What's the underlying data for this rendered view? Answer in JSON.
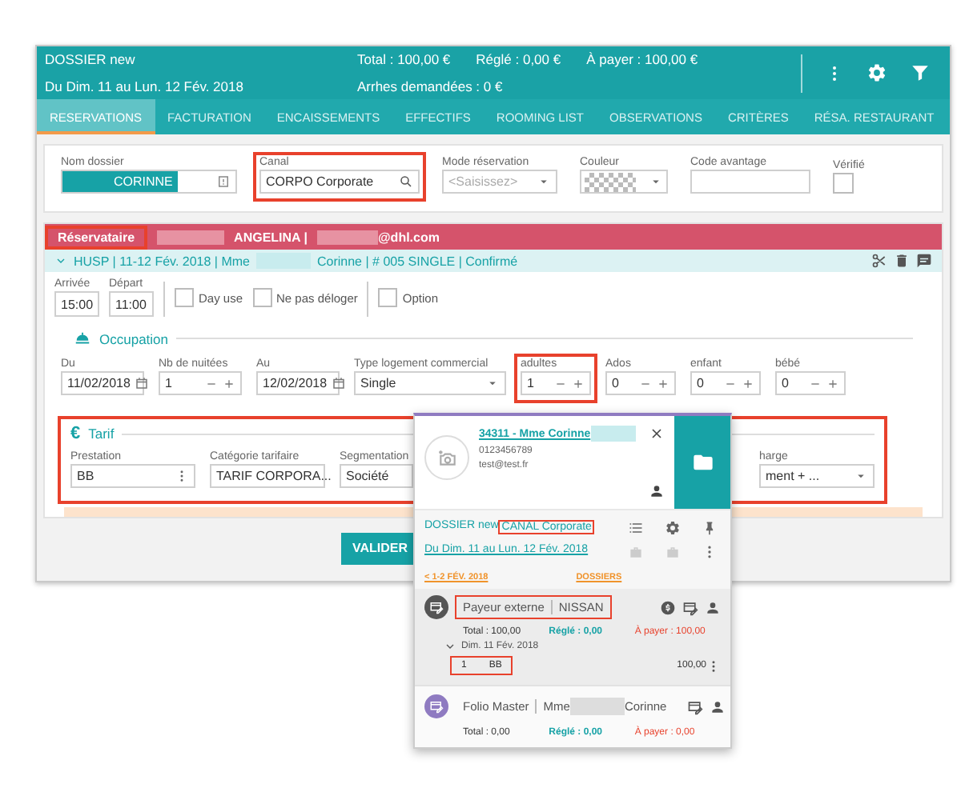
{
  "header": {
    "title": "DOSSIER new",
    "dates": "Du Dim. 11 au Lun. 12 Fév. 2018",
    "totals": [
      {
        "label": "Total :",
        "value": "100,00 €"
      },
      {
        "label": "Réglé :",
        "value": "0,00 €"
      },
      {
        "label": "À payer :",
        "value": "100,00 €"
      }
    ],
    "deposit": {
      "label": "Arrhes demandées :",
      "value": "0 €"
    }
  },
  "tabs": [
    {
      "label": "RESERVATIONS",
      "selected": true
    },
    {
      "label": "FACTURATION",
      "selected": false
    },
    {
      "label": "ENCAISSEMENTS",
      "selected": false
    },
    {
      "label": "EFFECTIFS",
      "selected": false
    },
    {
      "label": "ROOMING LIST",
      "selected": false
    },
    {
      "label": "OBSERVATIONS",
      "selected": false
    },
    {
      "label": "CRITÈRES",
      "selected": false
    },
    {
      "label": "RÉSA. RESTAURANT",
      "selected": false
    }
  ],
  "dossier_fields": [
    {
      "kind": "name",
      "label": "Nom dossier",
      "value": "CORINNE"
    },
    {
      "kind": "search",
      "label": "Canal",
      "value": "CORPO Corporate",
      "highlighted": true
    },
    {
      "kind": "select",
      "label": "Mode réservation",
      "placeholder": "<Saisissez>"
    },
    {
      "kind": "color",
      "label": "Couleur"
    },
    {
      "kind": "text",
      "label": "Code avantage"
    },
    {
      "kind": "check",
      "label": "Vérifié",
      "checked": false
    }
  ],
  "booker": {
    "label": "Réservataire",
    "highlighted": true,
    "name": "ANGELINA |",
    "email": "@dhl.com"
  },
  "stay": {
    "summary_start": "HUSP | 11-12 Fév. 2018 | Mme",
    "summary_end": "Corinne | # 005 SINGLE | Confirmé",
    "expanded": true
  },
  "times": [
    {
      "label": "Arrivée",
      "value": "15:00"
    },
    {
      "label": "Départ",
      "value": "11:00"
    }
  ],
  "options": [
    {
      "label": "Day use",
      "checked": false
    },
    {
      "label": "Ne pas déloger",
      "checked": false
    },
    {
      "label": "Option",
      "checked": false
    }
  ],
  "occupation": {
    "title": "Occupation",
    "fields": [
      {
        "kind": "date",
        "label": "Du",
        "value": "11/02/2018"
      },
      {
        "kind": "counter",
        "label": "Nb de nuitées",
        "value": "1"
      },
      {
        "kind": "date",
        "label": "Au",
        "value": "12/02/2018"
      },
      {
        "kind": "select",
        "label": "Type logement commercial",
        "value": "Single"
      },
      {
        "kind": "counter",
        "label": "adultes",
        "value": "1",
        "highlighted": true
      },
      {
        "kind": "counter",
        "label": "Ados",
        "value": "0"
      },
      {
        "kind": "counter",
        "label": "enfant",
        "value": "0"
      },
      {
        "kind": "counter",
        "label": "bébé",
        "value": "0"
      }
    ]
  },
  "tarif": {
    "icon": "€",
    "title": "Tarif",
    "highlighted": true,
    "fields": [
      {
        "kind": "menu",
        "label": "Prestation",
        "value": "BB"
      },
      {
        "kind": "select",
        "label": "Catégorie tarifaire",
        "value": "TARIF CORPORA..."
      },
      {
        "kind": "text",
        "label": "Segmentation",
        "value": "Société"
      },
      {
        "kind": "select",
        "label": "harge",
        "value": "ment + ..."
      }
    ]
  },
  "validate_button": "VALIDER",
  "popup": {
    "title": "34311 - Mme Corinne",
    "phone": "0123456789",
    "email": "test@test.fr",
    "dossier": "DOSSIER new",
    "canal": "CANAL Corporate",
    "canal_highlighted": true,
    "dates": "Du Dim. 11 au Lun. 12 Fév. 2018",
    "links": [
      "< 1-2 FÉV. 2018",
      "DOSSIERS"
    ],
    "folios": [
      {
        "kind": "external",
        "label": "Payeur externe",
        "name": "NISSAN",
        "highlighted": true,
        "total": "Total : 100,00",
        "paid": "Réglé : 0,00",
        "due": "À payer : 100,00",
        "date": "Dim. 11 Fév. 2018",
        "lines": [
          {
            "qty": "1",
            "code": "BB",
            "amount": "100,00",
            "highlighted": true
          }
        ]
      },
      {
        "kind": "master",
        "label": "Folio Master",
        "name": "Mme",
        "name_end": "Corinne",
        "total": "Total : 0,00",
        "paid": "Réglé : 0,00",
        "due": "À payer : 0,00"
      }
    ]
  }
}
